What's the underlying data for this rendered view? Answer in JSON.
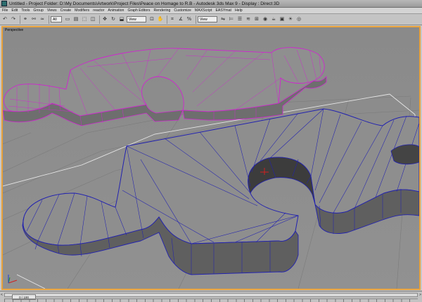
{
  "window": {
    "title": "Untitled     - Project Folder: D:\\My Documents\\Artwork\\Project Files\\Peace on Homage to R.B     - Autodesk 3ds Max 9     - Display : Direct 3D"
  },
  "menu": {
    "items": [
      "File",
      "Edit",
      "Tools",
      "Group",
      "Views",
      "Create",
      "Modifiers",
      "reactor",
      "Animation",
      "Graph Editors",
      "Rendering",
      "Customize",
      "MAXScript",
      "EASYmat",
      "Help"
    ]
  },
  "toolbar": {
    "selection_filter": "All",
    "ref_coord_system": "View",
    "ref_coord_system_2": "View"
  },
  "icons": {
    "undo": "↶",
    "redo": "↷",
    "link": "⚭",
    "unlink": "⚯",
    "bind": "≈",
    "select": "▭",
    "select_by_name": "▤",
    "rect_region": "⬚",
    "window_crossing": "◫",
    "move": "✥",
    "rotate": "↻",
    "scale": "⬓",
    "pivot": "⊡",
    "manipulate": "✋",
    "snap": "⌗",
    "angle_snap": "∡",
    "percent_snap": "%",
    "mirror": "⇋",
    "align": "⊨",
    "layers": "☰",
    "curve_editor": "≋",
    "schematic": "⊞",
    "material_editor": "◉",
    "render_setup": "☕",
    "render_frame": "▣",
    "quick_render": "☀",
    "render_type": "◎"
  },
  "viewport": {
    "label": "Perspective",
    "active_border_color": "#e8a23c",
    "background_color": "#8d8d8d"
  },
  "timeline": {
    "slider_label": "0 / 100",
    "arrow_left": "<",
    "arrow_right": ">"
  }
}
